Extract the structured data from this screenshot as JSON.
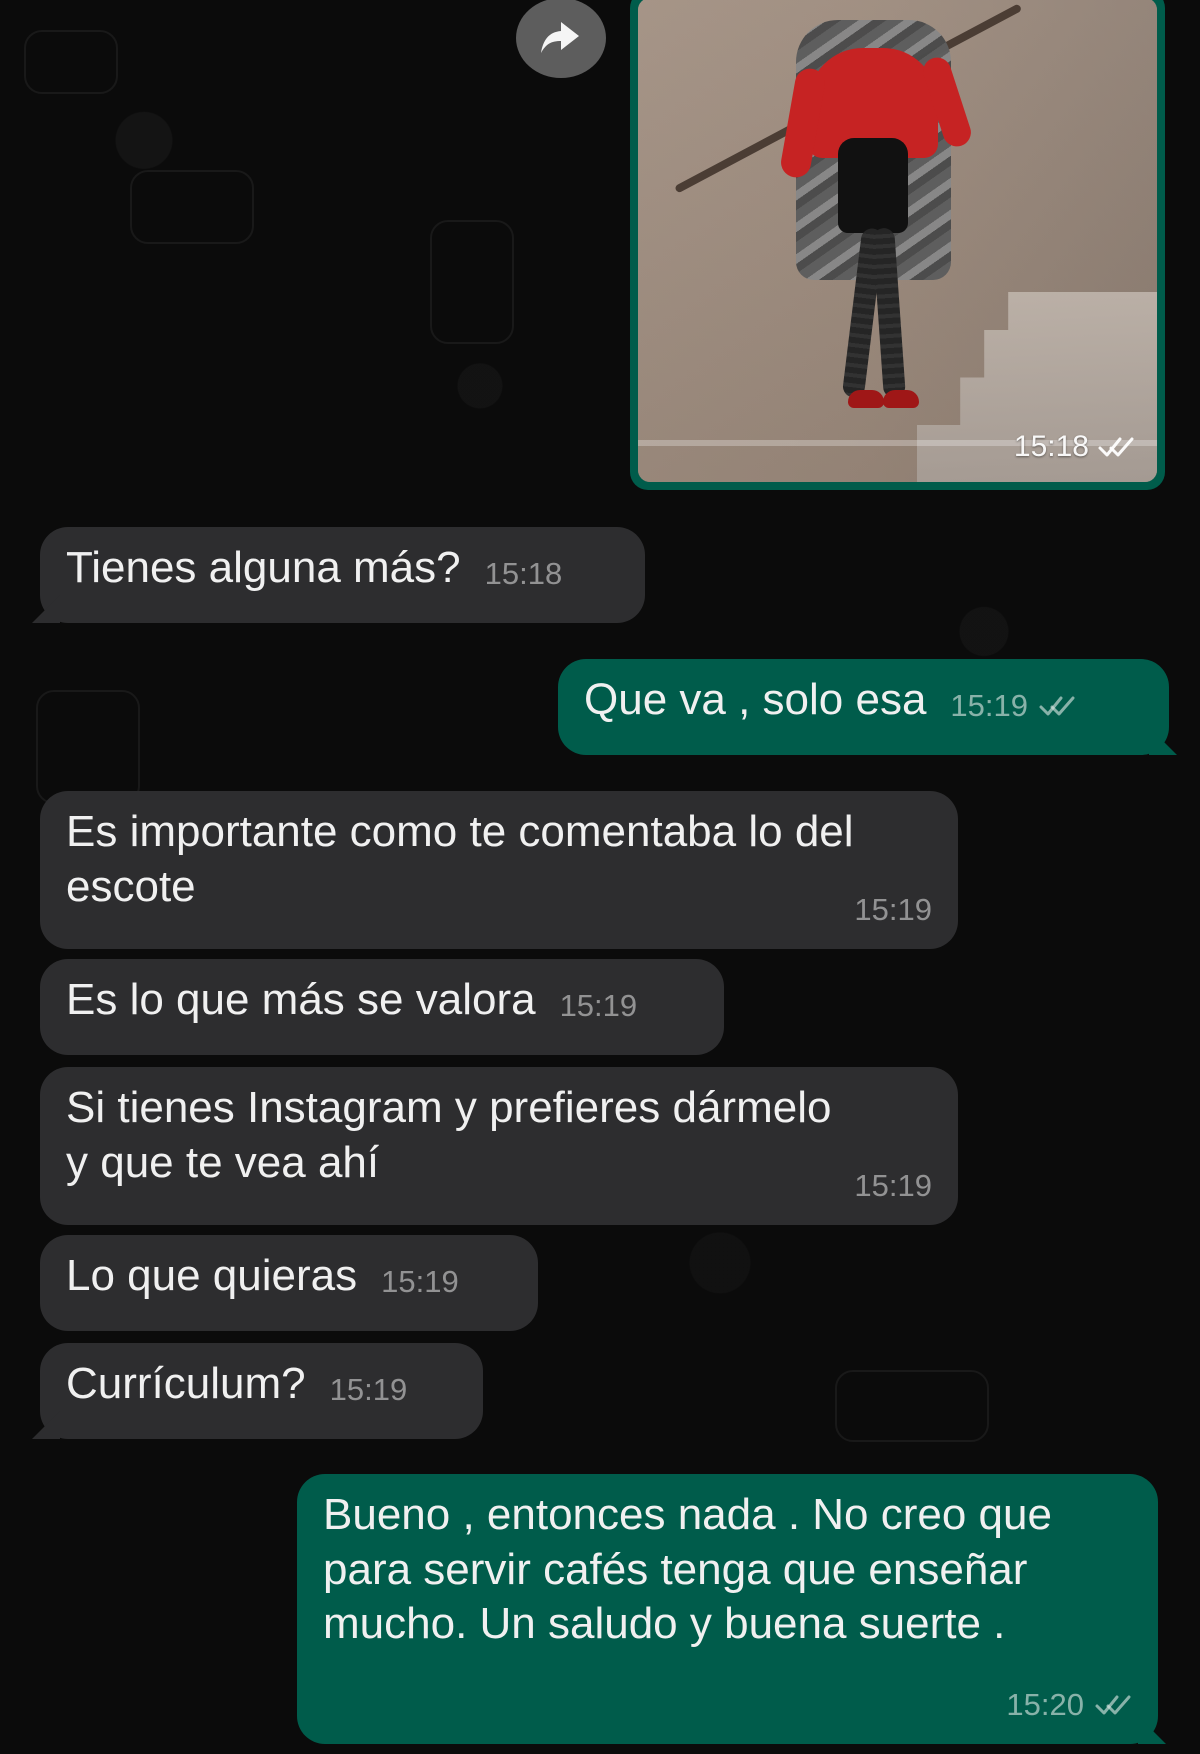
{
  "chat": {
    "image_message": {
      "time": "15:18",
      "status_icon": "double-check-icon"
    },
    "forward_icon": "forward-icon",
    "messages": [
      {
        "text": "Tienes alguna más?",
        "time": "15:18",
        "direction": "incoming"
      },
      {
        "text": "Que va , solo esa",
        "time": "15:19",
        "direction": "outgoing",
        "status_icon": "double-check-icon"
      },
      {
        "text": "Es importante como te comentaba lo del\nescote",
        "time": "15:19",
        "direction": "incoming"
      },
      {
        "text": "Es lo que más se valora",
        "time": "15:19",
        "direction": "incoming"
      },
      {
        "text": "Si tienes Instagram y prefieres dármelo\ny que te vea ahí",
        "time": "15:19",
        "direction": "incoming"
      },
      {
        "text": "Lo que quieras",
        "time": "15:19",
        "direction": "incoming"
      },
      {
        "text": "Currículum?",
        "time": "15:19",
        "direction": "incoming"
      },
      {
        "text": "Bueno , entonces nada . No creo que\npara servir cafés tenga que enseñar\nmucho. Un saludo y buena suerte .",
        "time": "15:20",
        "direction": "outgoing",
        "status_icon": "double-check-icon"
      }
    ]
  },
  "colors": {
    "background": "#0b0b0b",
    "incoming_bubble": "#2d2d2f",
    "outgoing_bubble": "#005c4b",
    "text": "#f0f0f0",
    "meta_text": "#a8a8a8"
  }
}
